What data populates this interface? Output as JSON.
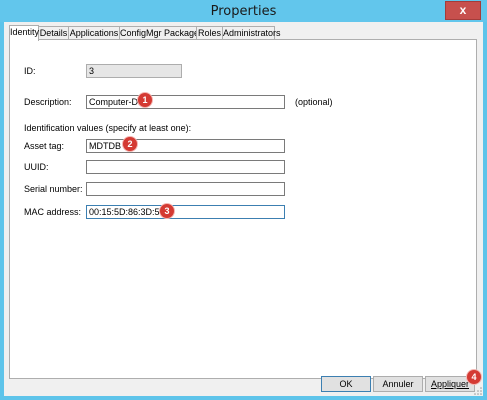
{
  "window": {
    "title": "Properties",
    "close_label": "x"
  },
  "tabs": [
    {
      "label": "Identity",
      "active": true
    },
    {
      "label": "Details"
    },
    {
      "label": "Applications"
    },
    {
      "label": "ConfigMgr Packages"
    },
    {
      "label": "Roles"
    },
    {
      "label": "Administrators"
    }
  ],
  "identity": {
    "id_label": "ID:",
    "id_value": "3",
    "description_label": "Description:",
    "description_value": "Computer-DB",
    "optional_note": "(optional)",
    "section_heading": "Identification values (specify at least one):",
    "asset_tag_label": "Asset tag:",
    "asset_tag_value": "MDTDB",
    "uuid_label": "UUID:",
    "uuid_value": "",
    "serial_label": "Serial number:",
    "serial_value": "",
    "mac_label": "MAC address:",
    "mac_value": "00:15:5D:86:3D:51"
  },
  "annotations": [
    "1",
    "2",
    "3",
    "4"
  ],
  "buttons": {
    "ok": "OK",
    "cancel": "Annuler",
    "apply": "Appliquer"
  },
  "colors": {
    "titlebar": "#62c6ec",
    "badge": "#d43a33",
    "close": "#c7504d"
  }
}
